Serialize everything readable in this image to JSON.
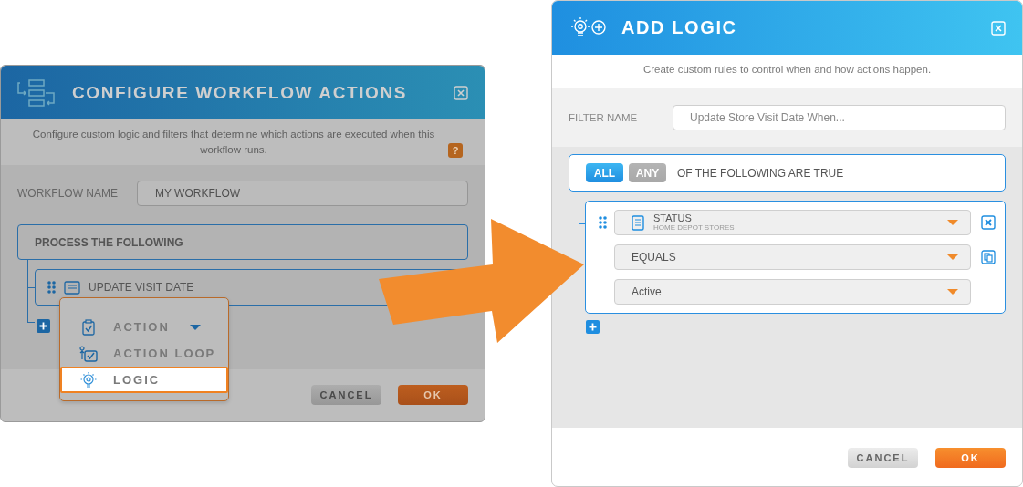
{
  "workflow_dialog": {
    "title": "CONFIGURE WORKFLOW ACTIONS",
    "description": "Configure custom logic and filters that determine which actions are executed when this workflow runs.",
    "help_badge": "?",
    "workflow_name": {
      "label": "WORKFLOW NAME",
      "value": "MY WORKFLOW"
    },
    "process": {
      "title": "PROCESS THE FOLLOWING",
      "steps": [
        {
          "label": "UPDATE VISIT DATE"
        }
      ]
    },
    "add_menu": {
      "items": [
        {
          "label": "ACTION",
          "kind": "action",
          "selected": false,
          "has_submenu": true
        },
        {
          "label": "ACTION LOOP",
          "kind": "loop",
          "selected": false,
          "has_submenu": false
        },
        {
          "label": "LOGIC",
          "kind": "logic",
          "selected": true,
          "has_submenu": false
        }
      ]
    },
    "buttons": [
      {
        "label": "CANCEL",
        "kind": "secondary"
      },
      {
        "label": "OK",
        "kind": "primary"
      }
    ]
  },
  "logic_dialog": {
    "title": "ADD LOGIC",
    "description": "Create custom rules to control when and how actions happen.",
    "filter_name": {
      "label": "FILTER NAME",
      "value": "Update Store Visit Date When..."
    },
    "match_toggle": [
      {
        "label": "ALL",
        "selected": true
      },
      {
        "label": "ANY",
        "selected": false
      }
    ],
    "match_text": "OF THE FOLLOWING ARE TRUE",
    "condition": {
      "field": {
        "label": "STATUS",
        "sublabel": "HOME DEPOT STORES"
      },
      "operator": "EQUALS",
      "value": "Active"
    },
    "buttons": [
      {
        "label": "CANCEL",
        "kind": "secondary"
      },
      {
        "label": "OK",
        "kind": "primary"
      }
    ]
  }
}
